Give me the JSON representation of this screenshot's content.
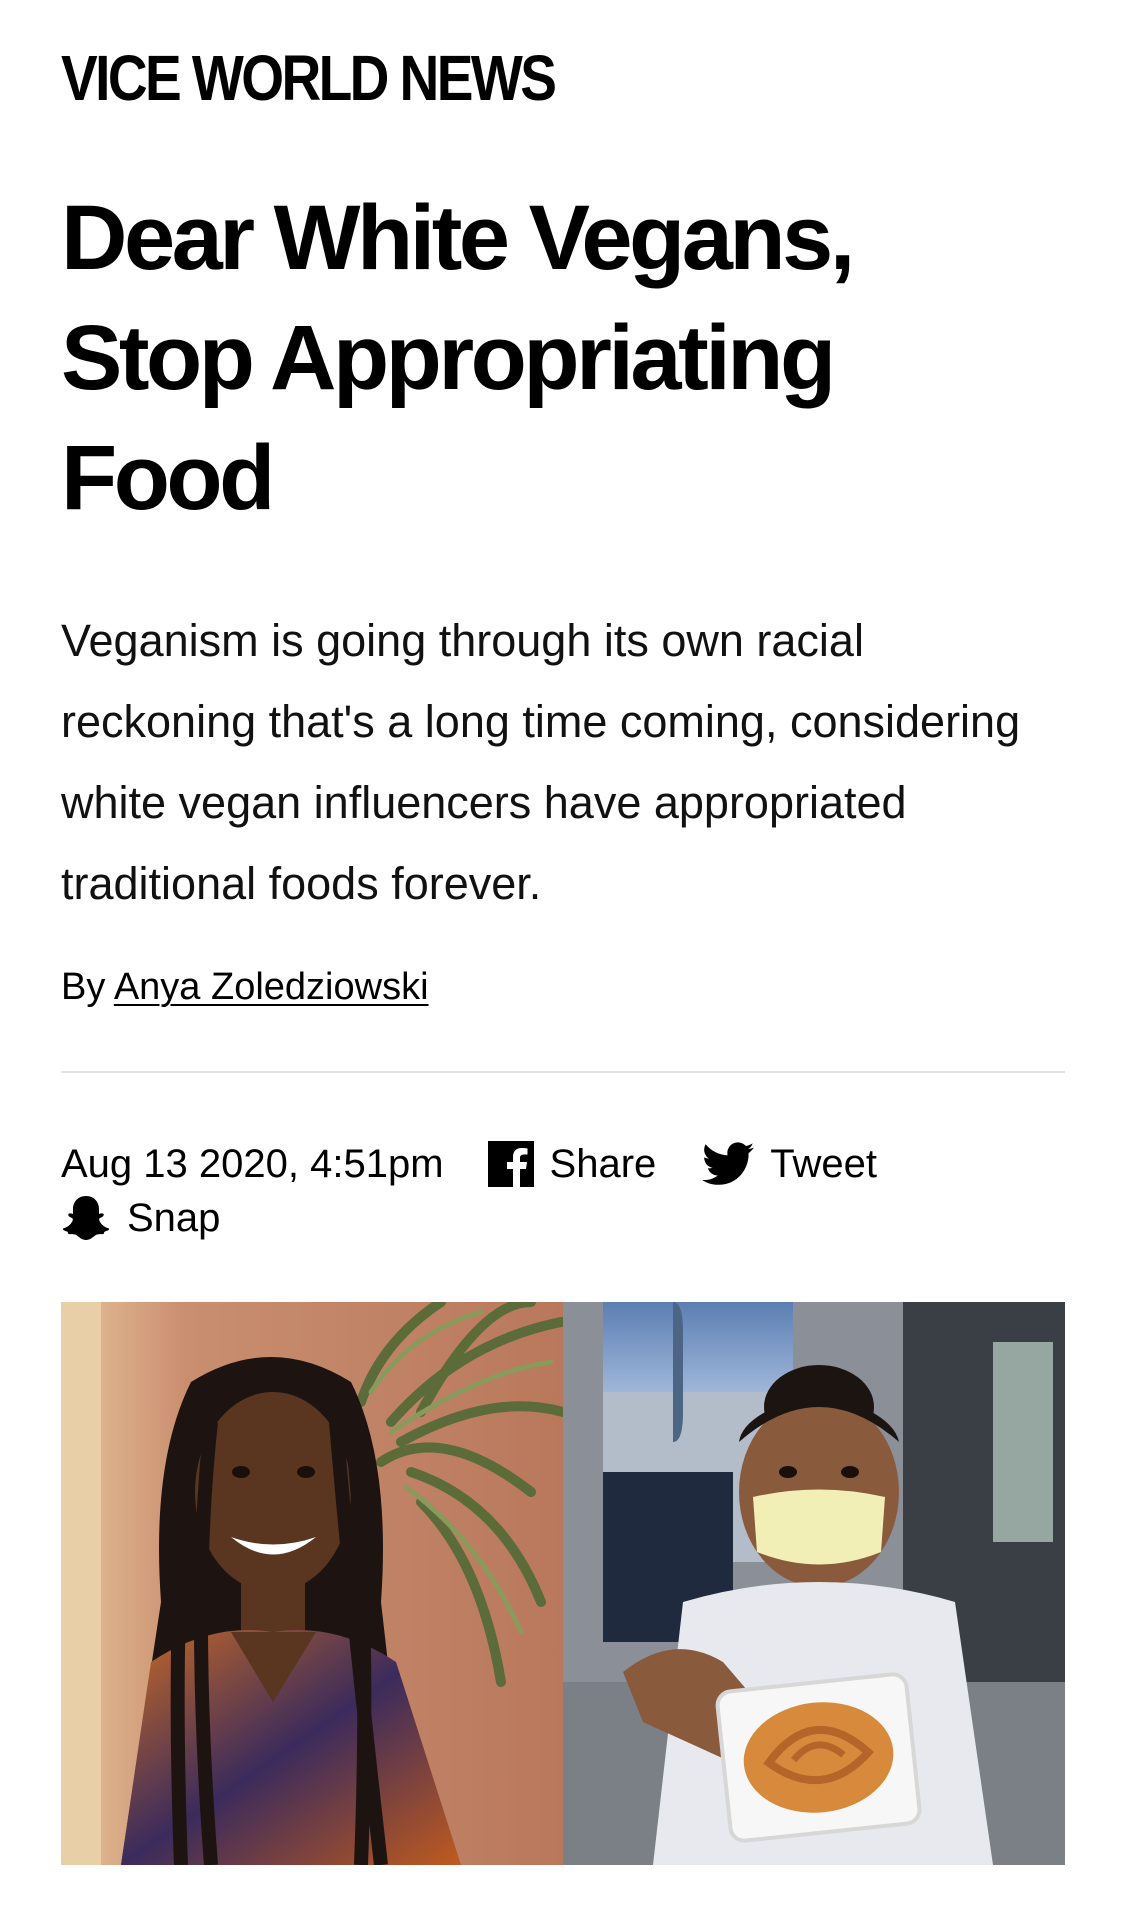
{
  "header": {
    "section": "VICE WORLD NEWS"
  },
  "article": {
    "title_lines": [
      "Dear White Vegans,",
      "Stop Appropriating",
      "Food"
    ],
    "dek": "Veganism is going through its own racial reckoning that's a long time coming, considering white vegan influencers have appropriated traditional foods forever.",
    "byline_prefix": "By",
    "author": "Anya Zoledziowski",
    "timestamp": "Aug 13 2020, 4:51pm"
  },
  "share": {
    "facebook_label": "Share",
    "twitter_label": "Tweet",
    "snapchat_label": "Snap"
  },
  "hero_image": {
    "left": "Smiling woman with long braids wearing a patterned dress in front of a palm plant",
    "right": "Woman in a face mask holding out a cinnamon roll in a takeout container"
  },
  "colors": {
    "text": "#000000",
    "divider": "#e2e2e2",
    "background": "#ffffff"
  },
  "icons": [
    "facebook-icon",
    "twitter-icon",
    "snapchat-icon"
  ]
}
